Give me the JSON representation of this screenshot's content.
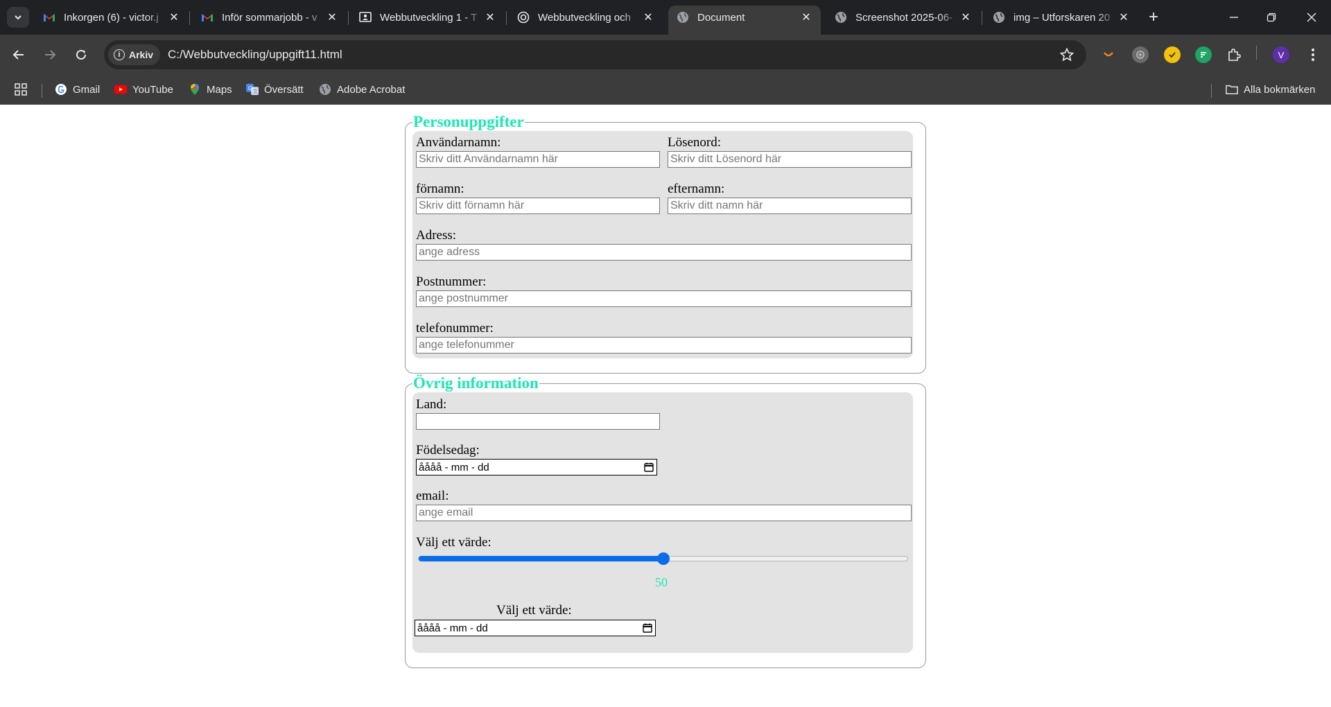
{
  "browser": {
    "tabs": [
      {
        "title": "Inkorgen (6) - victor.j",
        "icon": "gmail-icon",
        "active": false
      },
      {
        "title": "Inför sommarjobb - v",
        "icon": "gmail-icon",
        "active": false
      },
      {
        "title": "Webbutveckling 1 - T",
        "icon": "classroom-icon",
        "active": false
      },
      {
        "title": "Webbutveckling och",
        "icon": "openai-icon",
        "active": false
      },
      {
        "title": "Document",
        "icon": "globe-icon",
        "active": true
      },
      {
        "title": "Screenshot 2025-06-",
        "icon": "globe-icon",
        "active": false
      },
      {
        "title": "img – Utforskaren 20",
        "icon": "globe-icon",
        "active": false
      }
    ],
    "new_tab_label": "+",
    "address": {
      "chip_label": "Arkiv",
      "url": "C:/Webbutveckling/uppgift11.html"
    },
    "profile_initial": "V",
    "bookmarks": [
      {
        "label": "Gmail",
        "icon": "google-icon"
      },
      {
        "label": "YouTube",
        "icon": "youtube-icon"
      },
      {
        "label": "Maps",
        "icon": "maps-icon"
      },
      {
        "label": "Översätt",
        "icon": "translate-icon"
      },
      {
        "label": "Adobe Acrobat",
        "icon": "globe-icon"
      }
    ],
    "all_bookmarks_label": "Alla bokmärken"
  },
  "form": {
    "personal": {
      "legend": "Personuppgifter",
      "username_label": "Användarnamn:",
      "username_placeholder": "Skriv ditt Användarnamn här",
      "password_label": "Lösenord:",
      "password_placeholder": "Skriv ditt Lösenord här",
      "firstname_label": "förnamn:",
      "firstname_placeholder": "Skriv ditt förnamn här",
      "lastname_label": "efternamn:",
      "lastname_placeholder": "Skriv ditt namn här",
      "address_label": "Adress:",
      "address_placeholder": "ange adress",
      "postal_label": "Postnummer:",
      "postal_placeholder": "ange postnummer",
      "phone_label": "telefonummer:",
      "phone_placeholder": "ange telefonummer"
    },
    "other": {
      "legend": "Övrig information",
      "country_label": "Land:",
      "country_value": "",
      "birthday_label": "Födelsedag:",
      "birthday_display": "åååå - mm - dd",
      "email_label": "email:",
      "email_placeholder": "ange email",
      "range_label": "Välj ett värde:",
      "range_value": "50",
      "range_fraction": 0.5,
      "date2_label": "Välj ett värde:",
      "date2_display": "åååå - mm - dd"
    }
  },
  "colors": {
    "legend": "#1ee6b4",
    "slider": "#0a6de8",
    "panel": "#e3e3e3"
  }
}
